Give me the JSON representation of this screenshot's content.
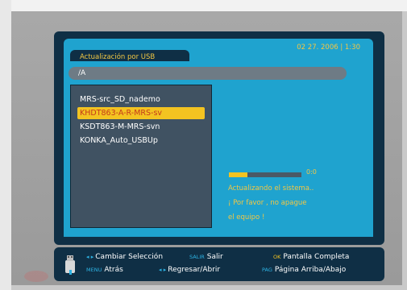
{
  "header": {
    "title": "Actualización por USB",
    "datetime": "02 27. 2006 | 1:30"
  },
  "path": "/A",
  "files": [
    {
      "name": "MRS-src_SD_nademo",
      "selected": false
    },
    {
      "name": "KHDT863-A-R-MRS-sv",
      "selected": true
    },
    {
      "name": "KSDT863-M-MRS-svn",
      "selected": false
    },
    {
      "name": "KONKA_Auto_USBUp",
      "selected": false
    }
  ],
  "progress": {
    "percent": 0.25,
    "label": "0:0"
  },
  "message": {
    "line1": "Actualizando el sistema..",
    "line2": "¡ Por favor , no apague",
    "line3": "el equipo !"
  },
  "footer": {
    "hint1_key": "◂ ▸",
    "hint1_label": "Cambiar Selección",
    "hint2_key": "SALIR",
    "hint2_label": "Salir",
    "hint3_key": "OK",
    "hint3_label": "Pantalla Completa",
    "hint4_key": "MENU",
    "hint4_label": "Atrás",
    "hint5_key": "◂ ▸",
    "hint5_label": "Regresar/Abrir",
    "hint6_key": "PAG",
    "hint6_label": "Página Arriba/Abajo"
  },
  "colors": {
    "accent": "#1fa3cf",
    "panel": "#0f2f45",
    "highlight": "#f3c321",
    "text_yellow": "#f3c743"
  }
}
